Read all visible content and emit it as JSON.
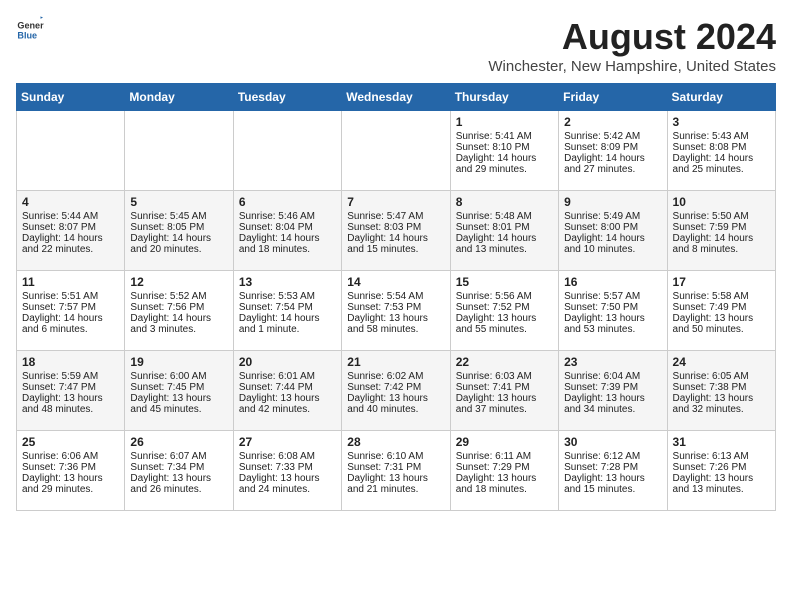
{
  "logo": {
    "general": "General",
    "blue": "Blue"
  },
  "header": {
    "month": "August 2024",
    "location": "Winchester, New Hampshire, United States"
  },
  "days_of_week": [
    "Sunday",
    "Monday",
    "Tuesday",
    "Wednesday",
    "Thursday",
    "Friday",
    "Saturday"
  ],
  "weeks": [
    [
      {
        "day": "",
        "content": ""
      },
      {
        "day": "",
        "content": ""
      },
      {
        "day": "",
        "content": ""
      },
      {
        "day": "",
        "content": ""
      },
      {
        "day": "1",
        "content": "Sunrise: 5:41 AM\nSunset: 8:10 PM\nDaylight: 14 hours\nand 29 minutes."
      },
      {
        "day": "2",
        "content": "Sunrise: 5:42 AM\nSunset: 8:09 PM\nDaylight: 14 hours\nand 27 minutes."
      },
      {
        "day": "3",
        "content": "Sunrise: 5:43 AM\nSunset: 8:08 PM\nDaylight: 14 hours\nand 25 minutes."
      }
    ],
    [
      {
        "day": "4",
        "content": "Sunrise: 5:44 AM\nSunset: 8:07 PM\nDaylight: 14 hours\nand 22 minutes."
      },
      {
        "day": "5",
        "content": "Sunrise: 5:45 AM\nSunset: 8:05 PM\nDaylight: 14 hours\nand 20 minutes."
      },
      {
        "day": "6",
        "content": "Sunrise: 5:46 AM\nSunset: 8:04 PM\nDaylight: 14 hours\nand 18 minutes."
      },
      {
        "day": "7",
        "content": "Sunrise: 5:47 AM\nSunset: 8:03 PM\nDaylight: 14 hours\nand 15 minutes."
      },
      {
        "day": "8",
        "content": "Sunrise: 5:48 AM\nSunset: 8:01 PM\nDaylight: 14 hours\nand 13 minutes."
      },
      {
        "day": "9",
        "content": "Sunrise: 5:49 AM\nSunset: 8:00 PM\nDaylight: 14 hours\nand 10 minutes."
      },
      {
        "day": "10",
        "content": "Sunrise: 5:50 AM\nSunset: 7:59 PM\nDaylight: 14 hours\nand 8 minutes."
      }
    ],
    [
      {
        "day": "11",
        "content": "Sunrise: 5:51 AM\nSunset: 7:57 PM\nDaylight: 14 hours\nand 6 minutes."
      },
      {
        "day": "12",
        "content": "Sunrise: 5:52 AM\nSunset: 7:56 PM\nDaylight: 14 hours\nand 3 minutes."
      },
      {
        "day": "13",
        "content": "Sunrise: 5:53 AM\nSunset: 7:54 PM\nDaylight: 14 hours\nand 1 minute."
      },
      {
        "day": "14",
        "content": "Sunrise: 5:54 AM\nSunset: 7:53 PM\nDaylight: 13 hours\nand 58 minutes."
      },
      {
        "day": "15",
        "content": "Sunrise: 5:56 AM\nSunset: 7:52 PM\nDaylight: 13 hours\nand 55 minutes."
      },
      {
        "day": "16",
        "content": "Sunrise: 5:57 AM\nSunset: 7:50 PM\nDaylight: 13 hours\nand 53 minutes."
      },
      {
        "day": "17",
        "content": "Sunrise: 5:58 AM\nSunset: 7:49 PM\nDaylight: 13 hours\nand 50 minutes."
      }
    ],
    [
      {
        "day": "18",
        "content": "Sunrise: 5:59 AM\nSunset: 7:47 PM\nDaylight: 13 hours\nand 48 minutes."
      },
      {
        "day": "19",
        "content": "Sunrise: 6:00 AM\nSunset: 7:45 PM\nDaylight: 13 hours\nand 45 minutes."
      },
      {
        "day": "20",
        "content": "Sunrise: 6:01 AM\nSunset: 7:44 PM\nDaylight: 13 hours\nand 42 minutes."
      },
      {
        "day": "21",
        "content": "Sunrise: 6:02 AM\nSunset: 7:42 PM\nDaylight: 13 hours\nand 40 minutes."
      },
      {
        "day": "22",
        "content": "Sunrise: 6:03 AM\nSunset: 7:41 PM\nDaylight: 13 hours\nand 37 minutes."
      },
      {
        "day": "23",
        "content": "Sunrise: 6:04 AM\nSunset: 7:39 PM\nDaylight: 13 hours\nand 34 minutes."
      },
      {
        "day": "24",
        "content": "Sunrise: 6:05 AM\nSunset: 7:38 PM\nDaylight: 13 hours\nand 32 minutes."
      }
    ],
    [
      {
        "day": "25",
        "content": "Sunrise: 6:06 AM\nSunset: 7:36 PM\nDaylight: 13 hours\nand 29 minutes."
      },
      {
        "day": "26",
        "content": "Sunrise: 6:07 AM\nSunset: 7:34 PM\nDaylight: 13 hours\nand 26 minutes."
      },
      {
        "day": "27",
        "content": "Sunrise: 6:08 AM\nSunset: 7:33 PM\nDaylight: 13 hours\nand 24 minutes."
      },
      {
        "day": "28",
        "content": "Sunrise: 6:10 AM\nSunset: 7:31 PM\nDaylight: 13 hours\nand 21 minutes."
      },
      {
        "day": "29",
        "content": "Sunrise: 6:11 AM\nSunset: 7:29 PM\nDaylight: 13 hours\nand 18 minutes."
      },
      {
        "day": "30",
        "content": "Sunrise: 6:12 AM\nSunset: 7:28 PM\nDaylight: 13 hours\nand 15 minutes."
      },
      {
        "day": "31",
        "content": "Sunrise: 6:13 AM\nSunset: 7:26 PM\nDaylight: 13 hours\nand 13 minutes."
      }
    ]
  ]
}
